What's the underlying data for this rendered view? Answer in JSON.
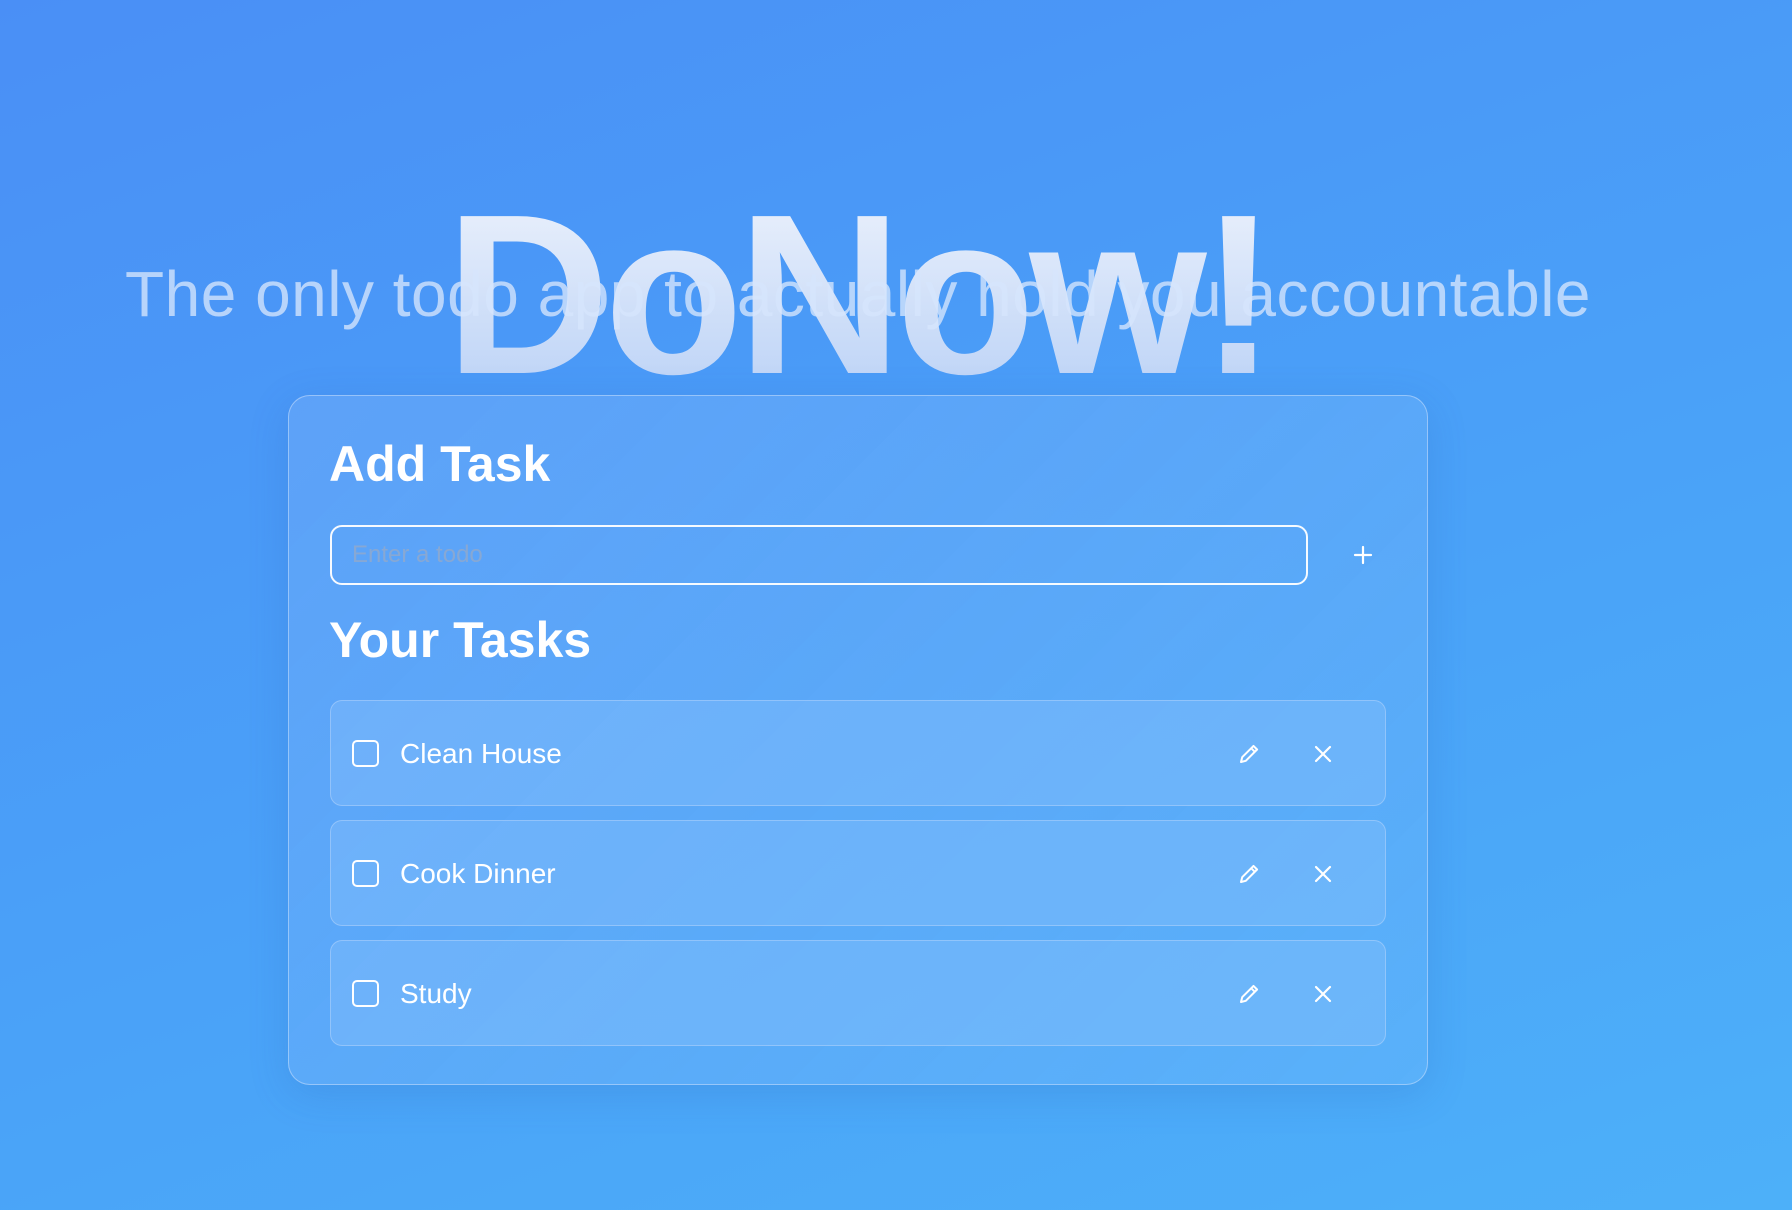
{
  "app": {
    "title": "DoNow!",
    "subtitle": "The only todo app to actually hold you accountable"
  },
  "add_task": {
    "heading": "Add Task",
    "input": {
      "placeholder": "Enter a todo",
      "value": ""
    },
    "add_button_icon": "plus-icon"
  },
  "tasks": {
    "heading": "Your Tasks",
    "items": [
      {
        "label": "Clean House",
        "checked": false,
        "edit_icon": "pencil-icon",
        "delete_icon": "close-icon"
      },
      {
        "label": "Cook Dinner",
        "checked": false,
        "edit_icon": "pencil-icon",
        "delete_icon": "close-icon"
      },
      {
        "label": "Study",
        "checked": false,
        "edit_icon": "pencil-icon",
        "delete_icon": "close-icon"
      }
    ]
  },
  "colors": {
    "background_start": "#4a8ff6",
    "background_end": "#4db0f9",
    "text": "#ffffff"
  }
}
